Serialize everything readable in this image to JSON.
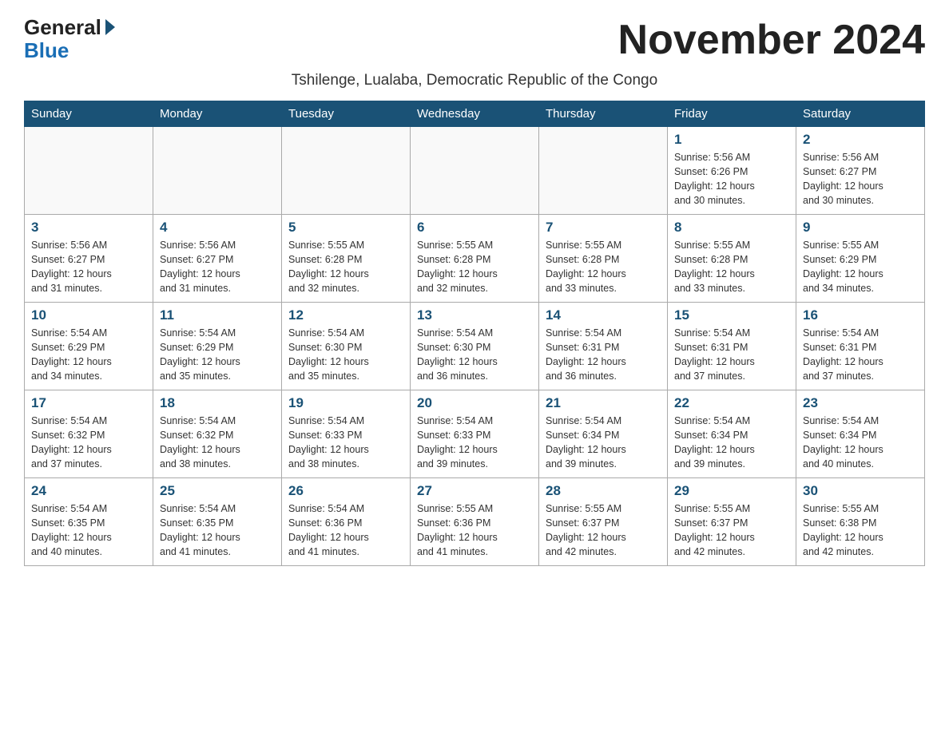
{
  "header": {
    "logo_general": "General",
    "logo_blue": "Blue",
    "month_title": "November 2024",
    "subtitle": "Tshilenge, Lualaba, Democratic Republic of the Congo"
  },
  "days_of_week": [
    "Sunday",
    "Monday",
    "Tuesday",
    "Wednesday",
    "Thursday",
    "Friday",
    "Saturday"
  ],
  "weeks": [
    [
      {
        "day": "",
        "info": ""
      },
      {
        "day": "",
        "info": ""
      },
      {
        "day": "",
        "info": ""
      },
      {
        "day": "",
        "info": ""
      },
      {
        "day": "",
        "info": ""
      },
      {
        "day": "1",
        "info": "Sunrise: 5:56 AM\nSunset: 6:26 PM\nDaylight: 12 hours\nand 30 minutes."
      },
      {
        "day": "2",
        "info": "Sunrise: 5:56 AM\nSunset: 6:27 PM\nDaylight: 12 hours\nand 30 minutes."
      }
    ],
    [
      {
        "day": "3",
        "info": "Sunrise: 5:56 AM\nSunset: 6:27 PM\nDaylight: 12 hours\nand 31 minutes."
      },
      {
        "day": "4",
        "info": "Sunrise: 5:56 AM\nSunset: 6:27 PM\nDaylight: 12 hours\nand 31 minutes."
      },
      {
        "day": "5",
        "info": "Sunrise: 5:55 AM\nSunset: 6:28 PM\nDaylight: 12 hours\nand 32 minutes."
      },
      {
        "day": "6",
        "info": "Sunrise: 5:55 AM\nSunset: 6:28 PM\nDaylight: 12 hours\nand 32 minutes."
      },
      {
        "day": "7",
        "info": "Sunrise: 5:55 AM\nSunset: 6:28 PM\nDaylight: 12 hours\nand 33 minutes."
      },
      {
        "day": "8",
        "info": "Sunrise: 5:55 AM\nSunset: 6:28 PM\nDaylight: 12 hours\nand 33 minutes."
      },
      {
        "day": "9",
        "info": "Sunrise: 5:55 AM\nSunset: 6:29 PM\nDaylight: 12 hours\nand 34 minutes."
      }
    ],
    [
      {
        "day": "10",
        "info": "Sunrise: 5:54 AM\nSunset: 6:29 PM\nDaylight: 12 hours\nand 34 minutes."
      },
      {
        "day": "11",
        "info": "Sunrise: 5:54 AM\nSunset: 6:29 PM\nDaylight: 12 hours\nand 35 minutes."
      },
      {
        "day": "12",
        "info": "Sunrise: 5:54 AM\nSunset: 6:30 PM\nDaylight: 12 hours\nand 35 minutes."
      },
      {
        "day": "13",
        "info": "Sunrise: 5:54 AM\nSunset: 6:30 PM\nDaylight: 12 hours\nand 36 minutes."
      },
      {
        "day": "14",
        "info": "Sunrise: 5:54 AM\nSunset: 6:31 PM\nDaylight: 12 hours\nand 36 minutes."
      },
      {
        "day": "15",
        "info": "Sunrise: 5:54 AM\nSunset: 6:31 PM\nDaylight: 12 hours\nand 37 minutes."
      },
      {
        "day": "16",
        "info": "Sunrise: 5:54 AM\nSunset: 6:31 PM\nDaylight: 12 hours\nand 37 minutes."
      }
    ],
    [
      {
        "day": "17",
        "info": "Sunrise: 5:54 AM\nSunset: 6:32 PM\nDaylight: 12 hours\nand 37 minutes."
      },
      {
        "day": "18",
        "info": "Sunrise: 5:54 AM\nSunset: 6:32 PM\nDaylight: 12 hours\nand 38 minutes."
      },
      {
        "day": "19",
        "info": "Sunrise: 5:54 AM\nSunset: 6:33 PM\nDaylight: 12 hours\nand 38 minutes."
      },
      {
        "day": "20",
        "info": "Sunrise: 5:54 AM\nSunset: 6:33 PM\nDaylight: 12 hours\nand 39 minutes."
      },
      {
        "day": "21",
        "info": "Sunrise: 5:54 AM\nSunset: 6:34 PM\nDaylight: 12 hours\nand 39 minutes."
      },
      {
        "day": "22",
        "info": "Sunrise: 5:54 AM\nSunset: 6:34 PM\nDaylight: 12 hours\nand 39 minutes."
      },
      {
        "day": "23",
        "info": "Sunrise: 5:54 AM\nSunset: 6:34 PM\nDaylight: 12 hours\nand 40 minutes."
      }
    ],
    [
      {
        "day": "24",
        "info": "Sunrise: 5:54 AM\nSunset: 6:35 PM\nDaylight: 12 hours\nand 40 minutes."
      },
      {
        "day": "25",
        "info": "Sunrise: 5:54 AM\nSunset: 6:35 PM\nDaylight: 12 hours\nand 41 minutes."
      },
      {
        "day": "26",
        "info": "Sunrise: 5:54 AM\nSunset: 6:36 PM\nDaylight: 12 hours\nand 41 minutes."
      },
      {
        "day": "27",
        "info": "Sunrise: 5:55 AM\nSunset: 6:36 PM\nDaylight: 12 hours\nand 41 minutes."
      },
      {
        "day": "28",
        "info": "Sunrise: 5:55 AM\nSunset: 6:37 PM\nDaylight: 12 hours\nand 42 minutes."
      },
      {
        "day": "29",
        "info": "Sunrise: 5:55 AM\nSunset: 6:37 PM\nDaylight: 12 hours\nand 42 minutes."
      },
      {
        "day": "30",
        "info": "Sunrise: 5:55 AM\nSunset: 6:38 PM\nDaylight: 12 hours\nand 42 minutes."
      }
    ]
  ]
}
